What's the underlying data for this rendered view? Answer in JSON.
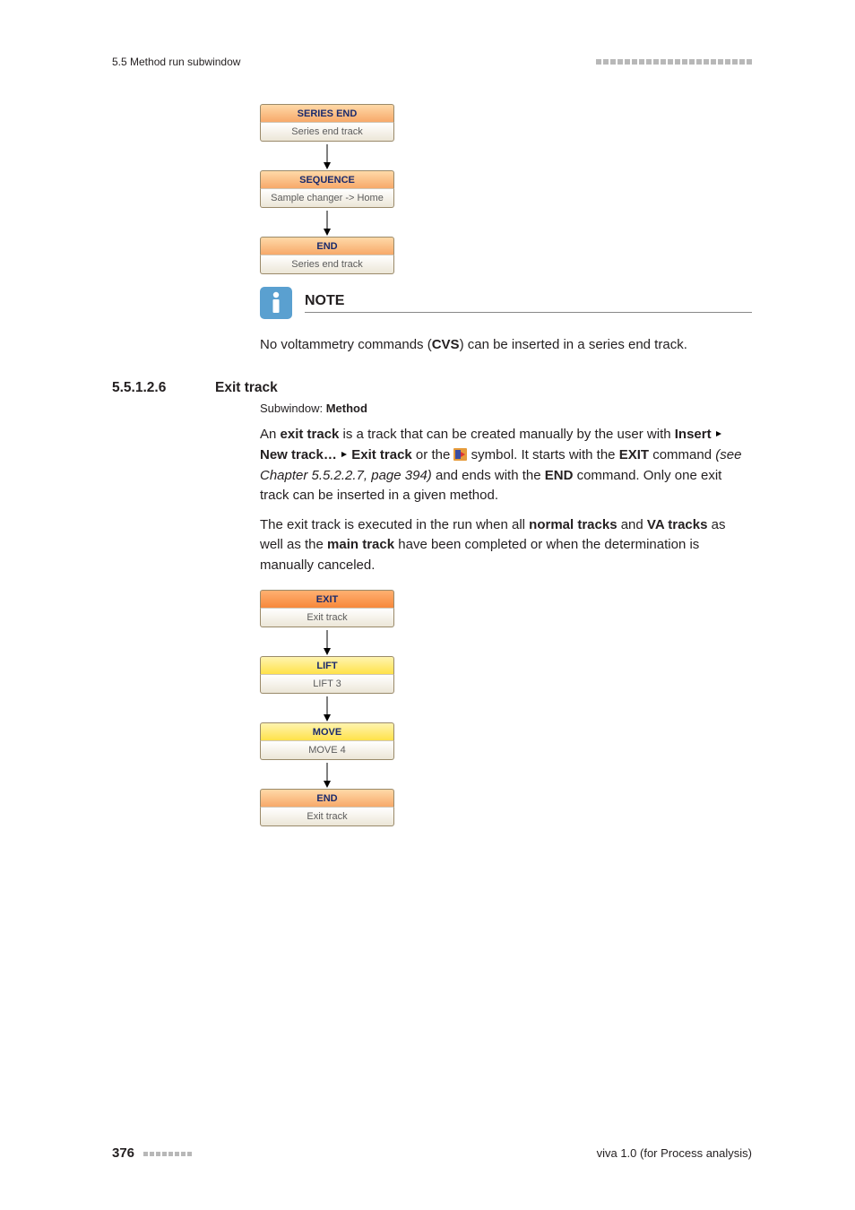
{
  "header": {
    "section_ref": "5.5 Method run subwindow"
  },
  "flow1": {
    "n1": {
      "head": "SERIES END",
      "sub": "Series end track"
    },
    "n2": {
      "head": "SEQUENCE",
      "sub": "Sample changer -> Home"
    },
    "n3": {
      "head": "END",
      "sub": "Series end track"
    }
  },
  "note": {
    "title": "NOTE",
    "body_prefix": "No voltammetry commands (",
    "body_bold": "CVS",
    "body_suffix": ") can be inserted in a series end track."
  },
  "section": {
    "number": "5.5.1.2.6",
    "title": "Exit track",
    "subwindow_label": "Subwindow: ",
    "subwindow_value": "Method"
  },
  "para1": {
    "t1": "An ",
    "b1": "exit track",
    "t2": " is a track that can be created manually by the user with ",
    "b2": "Insert",
    "b3": "New track…",
    "b4": "Exit track",
    "t3": " or the ",
    "t4": " symbol. It starts with the ",
    "b5": "EXIT",
    "t5": " command ",
    "i1": "(see Chapter 5.5.2.2.7, page 394)",
    "t6": " and ends with the ",
    "b6": "END",
    "t7": " command. Only one exit track can be inserted in a given method."
  },
  "para2": {
    "t1": "The exit track is executed in the run when all ",
    "b1": "normal tracks",
    "t2": " and ",
    "b2": "VA tracks",
    "t3": " as well as the ",
    "b3": "main track",
    "t4": " have been completed or when the determination is manually canceled."
  },
  "flow2": {
    "n1": {
      "head": "EXIT",
      "sub": "Exit track"
    },
    "n2": {
      "head": "LIFT",
      "sub": "LIFT 3"
    },
    "n3": {
      "head": "MOVE",
      "sub": "MOVE 4"
    },
    "n4": {
      "head": "END",
      "sub": "Exit track"
    }
  },
  "footer": {
    "page_number": "376",
    "product": "viva 1.0 (for Process analysis)"
  }
}
